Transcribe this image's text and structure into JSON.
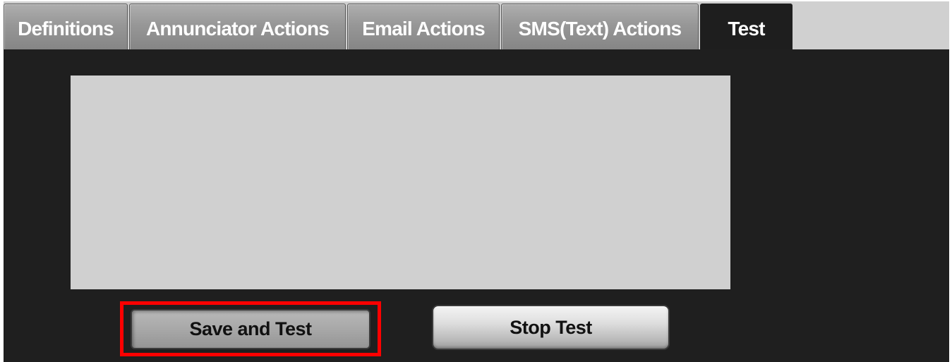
{
  "tabs": [
    {
      "label": "Definitions",
      "active": false
    },
    {
      "label": "Annunciator Actions",
      "active": false
    },
    {
      "label": "Email Actions",
      "active": false
    },
    {
      "label": "SMS(Text) Actions",
      "active": false
    },
    {
      "label": "Test",
      "active": true
    }
  ],
  "test_panel": {
    "output_text": "",
    "save_and_test_label": "Save and Test",
    "stop_test_label": "Stop Test"
  },
  "colors": {
    "panel_background": "#1f1f1f",
    "output_box": "#d0d0d0",
    "inactive_tab": "#979797",
    "highlight": "#ff0000"
  }
}
